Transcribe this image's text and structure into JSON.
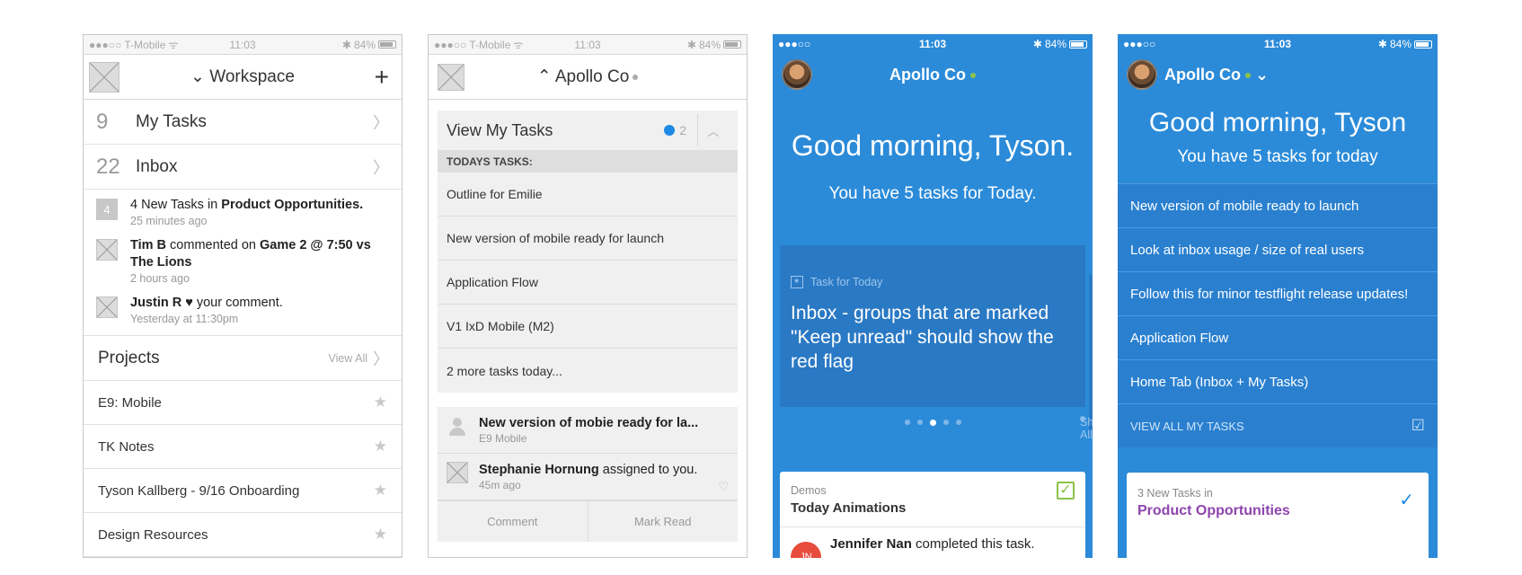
{
  "status": {
    "carrier": "●●●○○ T-Mobile",
    "wifi": "ᯤ",
    "time": "11:03",
    "battery": "84%",
    "bt": "✱",
    "carrier_blue": "●●●○○"
  },
  "s1": {
    "nav_title": "Workspace",
    "counts": [
      {
        "num": "9",
        "label": "My Tasks"
      },
      {
        "num": "22",
        "label": "Inbox"
      }
    ],
    "activity": [
      {
        "badge": "4",
        "pre": "4 New Tasks in ",
        "bold": "Product Opportunities.",
        "post": "",
        "time": "25 minutes ago"
      },
      {
        "pre": "",
        "bold": "Tim B",
        "post": " commented on ",
        "bold2": "Game 2 @ 7:50 vs The Lions",
        "time": "2 hours ago"
      },
      {
        "pre": "",
        "bold": "Justin R",
        "post": " ♥ your comment.",
        "time": "Yesterday at 11:30pm"
      }
    ],
    "projects_title": "Projects",
    "view_all": "View All",
    "projects": [
      "E9: Mobile",
      "TK Notes",
      "Tyson Kallberg - 9/16 Onboarding",
      "Design Resources"
    ]
  },
  "s2": {
    "nav_title": "Apollo Co",
    "card_title": "View My Tasks",
    "count": "2",
    "todays_header": "TODAYS TASKS:",
    "tasks": [
      "Outline for Emilie",
      "New version of mobile ready for launch",
      "Application Flow",
      "V1 IxD Mobile (M2)",
      "2 more tasks today..."
    ],
    "notifs": [
      {
        "bold": "New version of mobie ready for la...",
        "sub": "E9 Mobile"
      },
      {
        "bold": "Stephanie Hornung",
        "post": " assigned to you.",
        "sub": "45m ago"
      }
    ],
    "comment": "Comment",
    "mark_read": "Mark Read"
  },
  "s3": {
    "nav_title": "Apollo Co",
    "greeting": "Good morning, Tyson.",
    "subtitle": "You have 5 tasks for Today.",
    "slide_label": "Task for Today",
    "slide_msg": "Inbox - groups that are marked \"Keep unread\" should show the red flag",
    "show_all": "Show All",
    "card_kicker": "Demos",
    "card_title": "Today Animations",
    "initials": "JN",
    "line_bold": "Jennifer Nan",
    "line_post": " completed this task."
  },
  "s4": {
    "nav_title": "Apollo Co",
    "greeting": "Good morning, Tyson",
    "sub_pre": "You have ",
    "sub_num": "5",
    "sub_post": " tasks for today",
    "tasks": [
      "New version of mobile ready to launch",
      "Look at inbox usage / size of real users",
      "Follow this for minor testflight release updates!",
      "Application Flow",
      "Home Tab (Inbox + My Tasks)"
    ],
    "view_all": "VIEW ALL MY TASKS",
    "card_kicker": "3 New Tasks in",
    "card_title": "Product Opportunities"
  },
  "colors": {
    "blue_bg": "#2b8bd9",
    "accent_blue": "#1e88e5",
    "online_green": "#8bc34a",
    "purple": "#8e44ad"
  }
}
